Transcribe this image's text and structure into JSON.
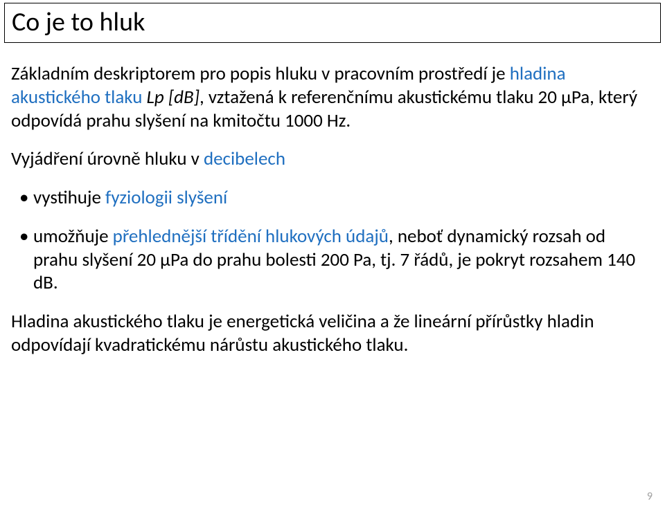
{
  "title": "Co je to hluk",
  "intro": {
    "pre": "Základním deskriptorem pro popis hluku v pracovním prostředí je ",
    "hladina_link": "hladina akustického tlaku",
    "mid": " ",
    "lp": "Lp [dB]",
    "post": ", vztažená k referenčnímu akustickému tlaku 20 μPa, který odpovídá prahu slyšení na kmitočtu 1000 Hz."
  },
  "decibel_line": {
    "pre": "Vyjádření úrovně hluku v ",
    "link": "decibelech"
  },
  "bullets": {
    "b1": {
      "pre": "vystihuje ",
      "link": "fyziologii slyšení"
    },
    "b2": {
      "pre": "umožňuje ",
      "link": "přehlednější třídění hlukových údajů",
      "post": ", neboť dynamický rozsah od prahu slyšení 20 μPa do prahu bolesti 200 Pa, tj. 7 řádů, je pokryt rozsahem 140 dB."
    }
  },
  "footer_para": "Hladina akustického tlaku je energetická veličina a že lineární přírůstky hladin odpovídají kvadratickému nárůstu akustického tlaku.",
  "page_number": "9"
}
